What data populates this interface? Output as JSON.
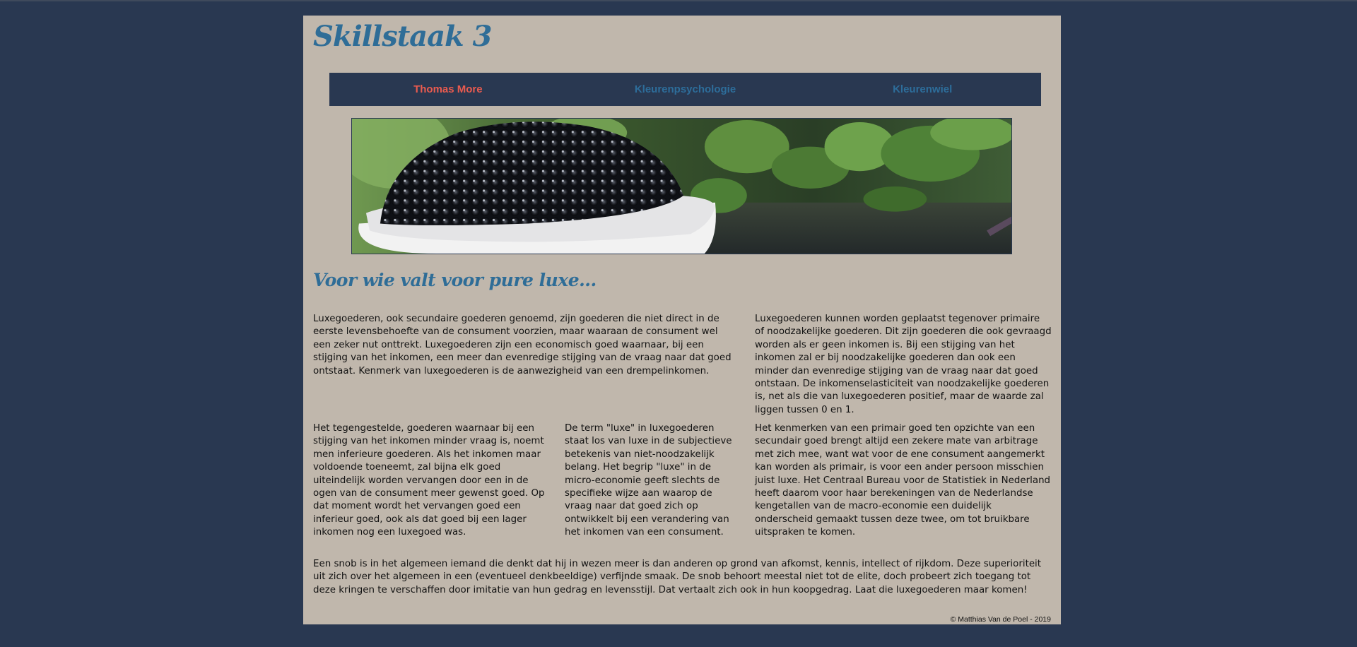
{
  "site": {
    "title": "Skillstaak 3"
  },
  "nav": {
    "items": [
      {
        "label": "Thomas More",
        "active": true
      },
      {
        "label": "Kleurenpsychologie",
        "active": false
      },
      {
        "label": "Kleurenwiel",
        "active": false
      }
    ]
  },
  "banner": {
    "icon": "caviar-banner-image"
  },
  "content": {
    "heading": "Voor wie valt voor pure luxe...",
    "paragraphs": [
      "Luxegoederen, ook secundaire goederen genoemd, zijn goederen die niet direct in de eerste levensbehoefte van de consument voorzien, maar waaraan de consument wel een zeker nut onttrekt. Luxegoederen zijn een economisch goed waarnaar, bij een stijging van het inkomen, een meer dan evenredige stijging van de vraag naar dat goed ontstaat. Kenmerk van luxegoederen is de aanwezigheid van een drempelinkomen.",
      "Luxegoederen kunnen worden geplaatst tegenover primaire of noodzakelijke goederen. Dit zijn goederen die ook gevraagd worden als er geen inkomen is. Bij een stijging van het inkomen zal er bij noodzakelijke goederen dan ook een minder dan evenredige stijging van de vraag naar dat goed ontstaan. De inkomenselasticiteit van noodzakelijke goederen is, net als die van luxegoederen positief, maar de waarde zal liggen tussen 0 en 1.",
      "Het tegengestelde, goederen waarnaar bij een stijging van het inkomen minder vraag is, noemt men inferieure goederen. Als het inkomen maar voldoende toeneemt, zal bijna elk goed uiteindelijk worden vervangen door een in de ogen van de consument meer gewenst goed. Op dat moment wordt het vervangen goed een inferieur goed, ook als dat goed bij een lager inkomen nog een luxegoed was.",
      "De term \"luxe\" in luxegoederen staat los van luxe in de subjectieve betekenis van niet-noodzakelijk belang. Het begrip \"luxe\" in de micro-economie geeft slechts de specifieke wijze aan waarop de vraag naar dat goed zich op ontwikkelt bij een verandering van het inkomen van een consument.",
      "Het kenmerken van een primair goed ten opzichte van een secundair goed brengt altijd een zekere mate van arbitrage met zich mee, want wat voor de ene consument aangemerkt kan worden als primair, is voor een ander persoon misschien juist luxe. Het Centraal Bureau voor de Statistiek in Nederland heeft daarom voor haar berekeningen van de Nederlandse kengetallen van de macro-economie een duidelijk onderscheid gemaakt tussen deze twee, om tot bruikbare uitspraken te komen.",
      "Een snob is in het algemeen iemand die denkt dat hij in wezen meer is dan anderen op grond van afkomst, kennis, intellect of rijkdom. Deze superioriteit uit zich over het algemeen in een (eventueel denkbeeldige) verfijnde smaak. De snob behoort meestal niet tot de elite, doch probeert zich toegang tot deze kringen te verschaffen door imitatie van hun gedrag en levensstijl. Dat vertaalt zich ook in hun koopgedrag. Laat die luxegoederen maar komen!"
    ]
  },
  "footer": {
    "text": "© Matthias Van de Poel - 2019"
  },
  "colors": {
    "background": "#293851",
    "page": "#c0b7ac",
    "accent": "#2f6d97",
    "nav_active": "#ea5b4f"
  }
}
